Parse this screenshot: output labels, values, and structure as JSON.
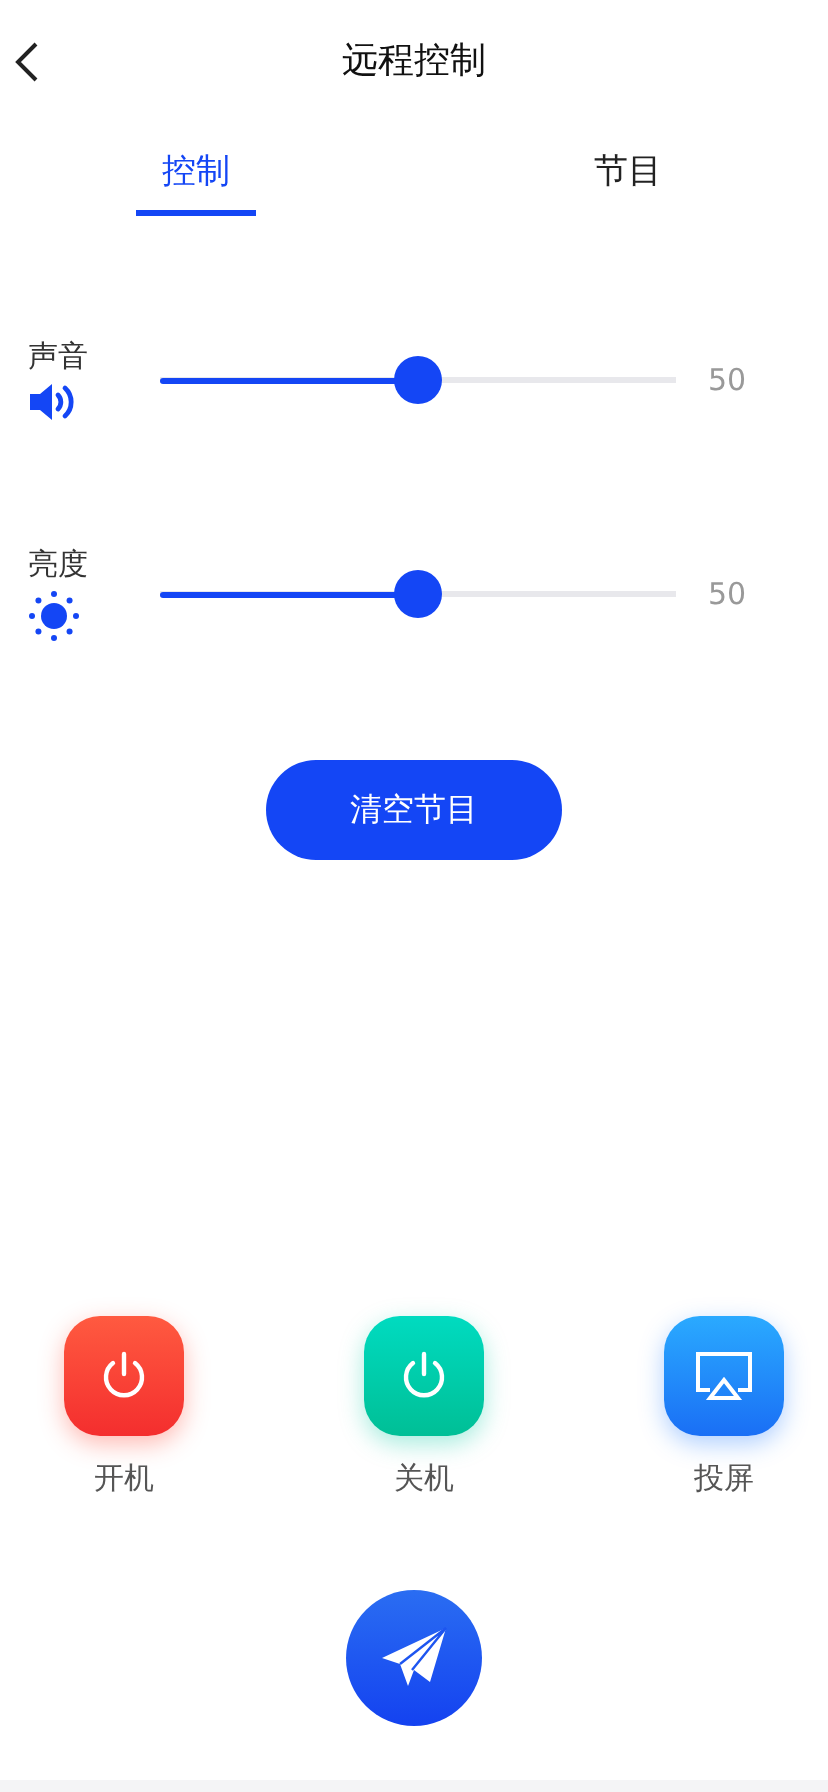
{
  "header": {
    "title": "远程控制"
  },
  "tabs": [
    {
      "label": "控制",
      "selected": true
    },
    {
      "label": "节目",
      "selected": false
    }
  ],
  "sliders": [
    {
      "kind": "volume",
      "label": "声音",
      "level": 0.5,
      "reading": "50"
    },
    {
      "kind": "brightness",
      "label": "亮度",
      "level": 0.5,
      "reading": "50"
    }
  ],
  "clear_button": "清空节目",
  "actions": [
    {
      "kind": "power-on",
      "label": "开机"
    },
    {
      "kind": "power-off",
      "label": "关机"
    },
    {
      "kind": "cast",
      "label": "投屏"
    }
  ]
}
